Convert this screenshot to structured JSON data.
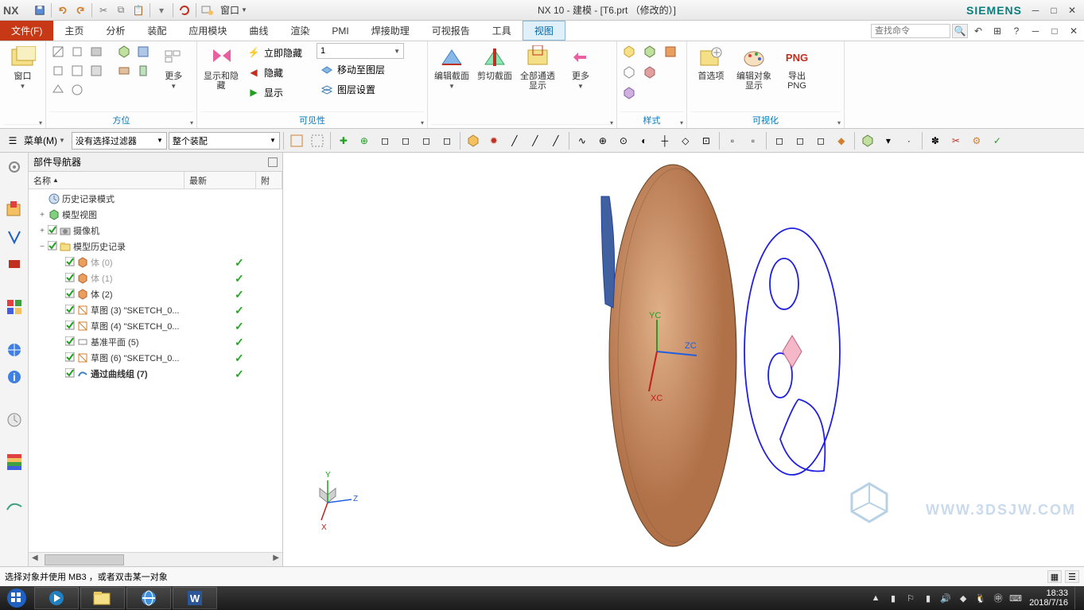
{
  "title": "NX 10 - 建模 - [T6.prt （修改的）]",
  "brand": "SIEMENS",
  "window_dropdown": "窗口",
  "file_menu": "文件(F)",
  "menus": [
    "主页",
    "分析",
    "装配",
    "应用模块",
    "曲线",
    "渲染",
    "PMI",
    "焊接助理",
    "可视报告",
    "工具",
    "视图"
  ],
  "active_menu_index": 10,
  "search_placeholder": "查找命令",
  "ribbon": {
    "group_window": "窗口",
    "group_orientation": "方位",
    "group_more1": "更多",
    "group_visibility": "可见性",
    "group_showhide": "显示和隐藏",
    "group_more2": "更多",
    "group_style": "样式",
    "group_visualize": "可视化",
    "btn_immediate_hide": "立即隐藏",
    "btn_hide": "隐藏",
    "btn_show": "显示",
    "btn_move_layer": "移动至图层",
    "btn_layer_settings": "图层设置",
    "btn_edit_section": "编辑截面",
    "btn_clip_section": "剪切截面",
    "btn_all_through": "全部通透显示",
    "btn_preferences": "首选项",
    "btn_edit_obj_disp": "编辑对象显示",
    "btn_export_png": "导出 PNG",
    "png_badge": "PNG",
    "combo_one": "1"
  },
  "selbar": {
    "menu_label": "菜单(M)",
    "filter_combo": "没有选择过滤器",
    "assembly_combo": "整个装配"
  },
  "nav": {
    "title": "部件导航器",
    "col_name": "名称",
    "col_latest": "最新",
    "col_extra": "附",
    "items": [
      {
        "exp": "",
        "indent": 0,
        "label": "历史记录模式",
        "icon": "clock",
        "chk": false,
        "latest": "",
        "dim": false
      },
      {
        "exp": "+",
        "indent": 0,
        "label": "模型视图",
        "icon": "cube-green",
        "chk": false,
        "latest": "",
        "dim": false
      },
      {
        "exp": "+",
        "indent": 0,
        "label": "摄像机",
        "icon": "camera",
        "chk": true,
        "latest": "",
        "dim": false
      },
      {
        "exp": "−",
        "indent": 0,
        "label": "模型历史记录",
        "icon": "folder",
        "chk": true,
        "latest": "",
        "dim": false
      },
      {
        "exp": "",
        "indent": 1,
        "label": "体 (0)",
        "icon": "body",
        "chk": true,
        "latest": "✓",
        "dim": true
      },
      {
        "exp": "",
        "indent": 1,
        "label": "体 (1)",
        "icon": "body",
        "chk": true,
        "latest": "✓",
        "dim": true
      },
      {
        "exp": "",
        "indent": 1,
        "label": "体 (2)",
        "icon": "body",
        "chk": true,
        "latest": "✓",
        "dim": false
      },
      {
        "exp": "",
        "indent": 1,
        "label": "草图 (3) \"SKETCH_0...",
        "icon": "sketch",
        "chk": true,
        "latest": "✓",
        "dim": false
      },
      {
        "exp": "",
        "indent": 1,
        "label": "草图 (4) \"SKETCH_0...",
        "icon": "sketch",
        "chk": true,
        "latest": "✓",
        "dim": false
      },
      {
        "exp": "",
        "indent": 1,
        "label": "基准平面 (5)",
        "icon": "plane",
        "chk": true,
        "latest": "✓",
        "dim": false
      },
      {
        "exp": "",
        "indent": 1,
        "label": "草图 (6) \"SKETCH_0...",
        "icon": "sketch",
        "chk": true,
        "latest": "✓",
        "dim": false
      },
      {
        "exp": "",
        "indent": 1,
        "label": "通过曲线组 (7)",
        "icon": "curve",
        "chk": true,
        "latest": "✓",
        "dim": false,
        "bold": true
      }
    ]
  },
  "triad": {
    "x": "XC",
    "y": "YC",
    "z": "ZC"
  },
  "mini_triad": {
    "x": "X",
    "y": "Y",
    "z": "Z"
  },
  "status_msg": "选择对象并使用 MB3 ，或者双击某一对象",
  "watermark": "WWW.3DSJW.COM",
  "clock_time": "18:33",
  "clock_date": "2018/7/16"
}
